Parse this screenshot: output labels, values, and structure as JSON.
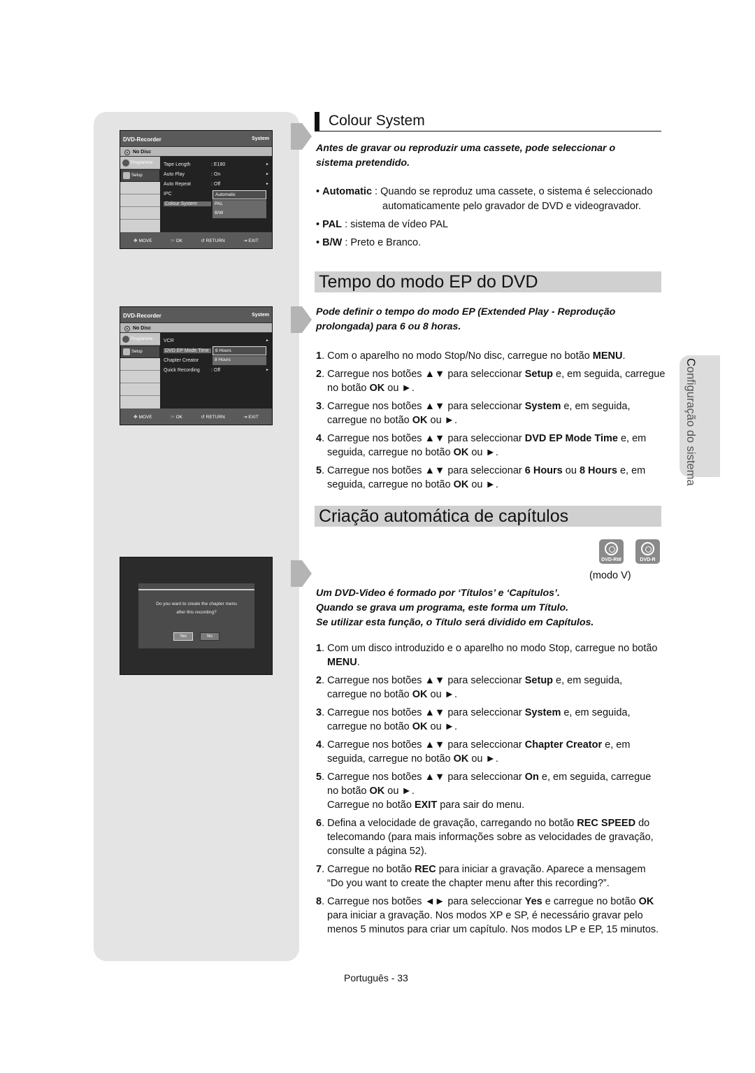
{
  "osd_common": {
    "app_title": "DVD-Recorder",
    "section": "System",
    "disc_status": "No Disc",
    "sidebar": [
      {
        "label": "Programme",
        "icon": "programme-icon"
      },
      {
        "label": "Setup",
        "icon": "gear-icon"
      }
    ],
    "footer": {
      "move": "MOVE",
      "ok": "OK",
      "return": "RETURN",
      "exit": "EXIT"
    }
  },
  "osd_colour": {
    "rows": [
      {
        "label": "Tape Length",
        "value": ": E180",
        "arrow": "►"
      },
      {
        "label": "Auto Play",
        "value": ": On",
        "arrow": "►"
      },
      {
        "label": "Auto Repeat",
        "value": ": Off",
        "arrow": "►"
      },
      {
        "label": "IPC",
        "value": "",
        "arrow": ""
      },
      {
        "label": "Colour System",
        "value": "",
        "arrow": ""
      }
    ],
    "options": [
      "Automatic",
      "PAL",
      "B/W"
    ],
    "selected_option": "Automatic"
  },
  "osd_ep": {
    "rows": [
      {
        "label": "VCR",
        "value": "",
        "arrow": "►"
      },
      {
        "label": "DVD EP Mode Time",
        "value": "",
        "arrow": ""
      },
      {
        "label": "Chapter Creator",
        "value": "",
        "arrow": ""
      },
      {
        "label": "Quick Recording",
        "value": ": Off",
        "arrow": "►"
      }
    ],
    "options": [
      "6 Hours",
      "8 Hours"
    ],
    "selected_option": "6 Hours"
  },
  "osd_chapter": {
    "message_line1": "Do you want to create the chapter menu",
    "message_line2": "after this recording?",
    "yes_label": "Yes",
    "no_label": "No"
  },
  "colour_system": {
    "title": "Colour System",
    "intro": "Antes de gravar ou reproduzir uma cassete, pode seleccionar o sistema pretendido.",
    "bullets": [
      {
        "term": "Automatic",
        "sep": " : ",
        "text": "Quando se reproduz uma cassete, o sistema é seleccionado",
        "text2": "automaticamente pelo gravador de DVD e videogravador."
      },
      {
        "term": "PAL",
        "sep": " : ",
        "text": "sistema de vídeo PAL"
      },
      {
        "term": "B/W",
        "sep": " : ",
        "text": "Preto e Branco."
      }
    ]
  },
  "ep_mode": {
    "title": "Tempo do modo EP do DVD",
    "intro": "Pode definir o tempo do modo EP (Extended Play - Reprodução prolongada) para 6 ou 8 horas.",
    "steps": [
      [
        "1",
        ". Com o aparelho no modo Stop/No disc, carregue no botão ",
        "MENU",
        "."
      ],
      [
        "2",
        ". Carregue nos botões ▲▼ para seleccionar ",
        "Setup",
        " e, em seguida, carregue no botão ",
        "OK",
        " ou ►."
      ],
      [
        "3",
        ". Carregue nos botões ▲▼ para seleccionar ",
        "System",
        " e, em seguida, carregue no botão ",
        "OK",
        " ou ►."
      ],
      [
        "4",
        ". Carregue nos botões ▲▼ para seleccionar ",
        "DVD EP Mode Time",
        " e, em seguida, carregue no botão ",
        "OK",
        " ou ►."
      ],
      [
        "5",
        ". Carregue nos botões ▲▼ para seleccionar ",
        "6 Hours",
        " ou ",
        "8 Hours",
        " e, em seguida, carregue no botão ",
        "OK",
        " ou ►."
      ]
    ]
  },
  "chapter": {
    "title": "Criação automática de capítulos",
    "badges": [
      "DVD-RW",
      "DVD-R"
    ],
    "mode_note": "(modo V)",
    "intro_lines": [
      "Um DVD-Video é formado por ‘Títulos’ e ‘Capítulos’.",
      "Quando se grava um programa, este forma um Título.",
      "Se utilizar esta função, o Título será dividido em Capítulos."
    ],
    "steps": [
      [
        "1",
        ". Com um disco introduzido e o aparelho no modo Stop, carregue no botão ",
        "MENU",
        "."
      ],
      [
        "2",
        ". Carregue nos botões ▲▼ para seleccionar ",
        "Setup",
        " e, em seguida, carregue no botão ",
        "OK",
        " ou ►."
      ],
      [
        "3",
        ". Carregue nos botões ▲▼ para seleccionar ",
        "System",
        " e, em seguida, carregue no botão ",
        "OK",
        " ou ►."
      ],
      [
        "4",
        ". Carregue nos botões ▲▼ para seleccionar ",
        "Chapter Creator",
        " e, em seguida, carregue no botão ",
        "OK",
        " ou ►."
      ],
      [
        "5",
        ". Carregue nos botões ▲▼ para seleccionar ",
        "On",
        " e, em seguida, carregue no botão ",
        "OK",
        " ou ►.\nCarregue no botão ",
        "EXIT",
        " para sair do menu."
      ],
      [
        "6",
        ". Defina a velocidade de gravação, carregando no botão ",
        "REC SPEED",
        " do telecomando (para mais informações sobre as velocidades de gravação, consulte a página 52)."
      ],
      [
        "7",
        ". Carregue no botão ",
        "REC",
        " para iniciar a gravação. Aparece a mensagem “Do you want to create the chapter menu after this recording?”."
      ],
      [
        "8",
        ". Carregue nos botões ◄► para seleccionar ",
        "Yes",
        " e carregue no botão ",
        "OK",
        " para iniciar a gravação. Nos modos XP e SP, é necessário gravar pelo menos 5 minutos para criar um capítulo. Nos modos LP e EP, 15 minutos."
      ]
    ]
  },
  "side_tab": {
    "cap": "C",
    "rest": "onfiguração do sistema"
  },
  "footer": {
    "page_label": "Português - 33"
  }
}
